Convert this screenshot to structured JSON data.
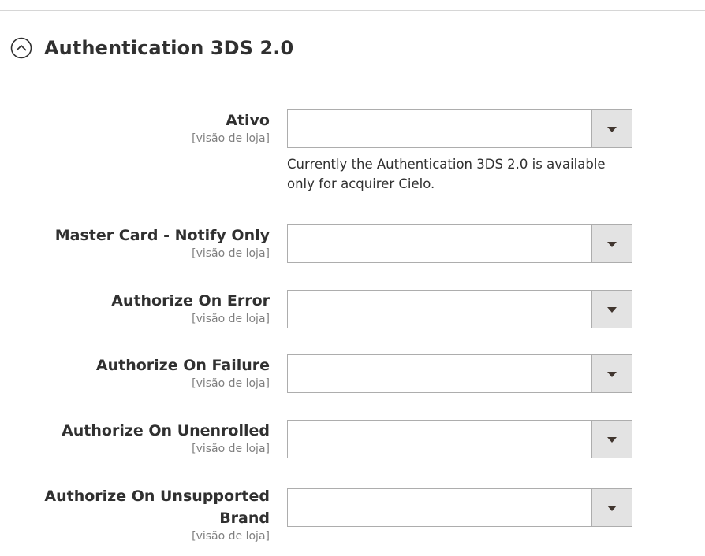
{
  "section": {
    "title": "Authentication 3DS 2.0",
    "collapse_icon": "chevron-up-circle-icon"
  },
  "fields": [
    {
      "label": "Ativo",
      "scope": "[visão de loja]",
      "value": "",
      "note": "Currently the Authentication 3DS 2.0 is available only for acquirer Cielo."
    },
    {
      "label": "Master Card - Notify Only",
      "scope": "[visão de loja]",
      "value": ""
    },
    {
      "label": "Authorize On Error",
      "scope": "[visão de loja]",
      "value": ""
    },
    {
      "label": "Authorize On Failure",
      "scope": "[visão de loja]",
      "value": ""
    },
    {
      "label": "Authorize On Unenrolled",
      "scope": "[visão de loja]",
      "value": ""
    },
    {
      "label": "Authorize On Unsupported Brand",
      "scope": "[visão de loja]",
      "value": ""
    }
  ],
  "colors": {
    "text": "#303030",
    "scope": "#808080",
    "border": "#adadad",
    "arrow_bg": "#e3e3e3",
    "caret": "#41362f"
  }
}
